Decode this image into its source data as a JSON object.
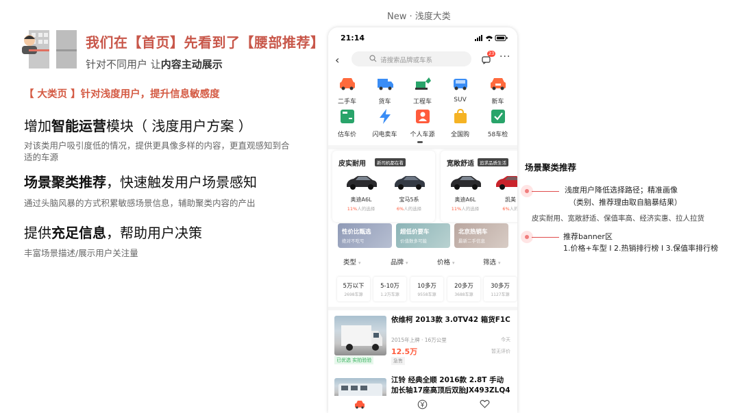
{
  "slide": {
    "headline": "我们在【首页】先看到了【腰部推荐】",
    "subline_a": "针对不同用户  让",
    "subline_b": "内容主动展示",
    "category_title": "【 大类页 】针对浅度用户，提升信息敏感度",
    "points": [
      {
        "pre": "增加",
        "bold": "智能运营",
        "post": "模块（ 浅度用户方案 ）",
        "desc": "对该类用户吸引度低的情况，提供更具像多样的内容，更直观感知到合适的车源"
      },
      {
        "pre": "",
        "bold": "场景聚类推荐",
        "post": "，快速触发用户场景感知",
        "desc": "通过头脑风暴的方式积累敏感场景信息，辅助聚类内容的产出"
      },
      {
        "pre": "提供",
        "bold": "充足信息",
        "post": "，帮助用户决策",
        "desc": "丰富场景描述/展示用户关注量"
      }
    ]
  },
  "phone": {
    "caption": "New · 浅度大类",
    "time": "21:14",
    "search_placeholder": "请搜索品牌或车系",
    "msg_badge": "23",
    "categories_row1": [
      "二手车",
      "货车",
      "工程车",
      "SUV",
      "新车"
    ],
    "categories_row2": [
      "估车价",
      "闪电卖车",
      "个人车源",
      "全国购",
      "58车检"
    ],
    "scenes": [
      {
        "title": "皮实耐用",
        "tag": "新司机都在看",
        "cars": [
          {
            "name": "奥迪A6L",
            "pct": "11%",
            "suffix": "人的选择"
          },
          {
            "name": "宝马5系",
            "pct": "6%",
            "suffix": "人的选择"
          }
        ]
      },
      {
        "title": "宽敞舒适",
        "tag": "追求品质生活",
        "cars": [
          {
            "name": "奥迪A6L",
            "pct": "11%",
            "suffix": "人的选择"
          },
          {
            "name": "凯美",
            "pct": "6%",
            "suffix": "人的"
          }
        ]
      }
    ],
    "banners": [
      {
        "title": "性价比甄选",
        "sub": "绝对不吃亏"
      },
      {
        "title": "超低价要车",
        "sub": "价值数多可能"
      },
      {
        "title": "北京热销车",
        "sub": "最新二手信息"
      }
    ],
    "filters": [
      "类型",
      "品牌",
      "价格",
      "筛选"
    ],
    "price_chips": [
      {
        "title": "5万以下",
        "count": "2698车源"
      },
      {
        "title": "5-10万",
        "count": "1.2万车源"
      },
      {
        "title": "10多万",
        "count": "9558车源"
      },
      {
        "title": "20多万",
        "count": "3688车源"
      },
      {
        "title": "30多万",
        "count": "1127车源"
      }
    ],
    "listings": [
      {
        "title": "依维柯 2013款 3.0TV42 箱货F1C",
        "meta": "2015年上牌 · 16万公里",
        "price": "12.5万",
        "right_top": "今天",
        "right_bottom": "暂无评价",
        "green_tag": "已优选  实拍验验",
        "gray_tag": "急售"
      },
      {
        "title": "江铃 经典全顺 2016款 2.8T 手动 加长轴17座高顶后双胎JX493ZLQ4"
      }
    ]
  },
  "annotations": {
    "title": "场景聚类推荐",
    "a1_line1": "浅度用户降低选择路径；精准画像",
    "a1_line2": "（类别、推荐理由取自脑暴结果）",
    "a1_detail": "皮实耐用、宽敞舒适、保值率高、经济实惠、拉人拉货",
    "a2_line1": "推荐banner区",
    "a2_line2": "1.价格+车型  I  2.热销排行榜  I  3.保值率排行榜"
  },
  "colors": {
    "accent": "#c8574a",
    "price": "#ff5b3c",
    "annotation_line": "#e04b4b"
  }
}
